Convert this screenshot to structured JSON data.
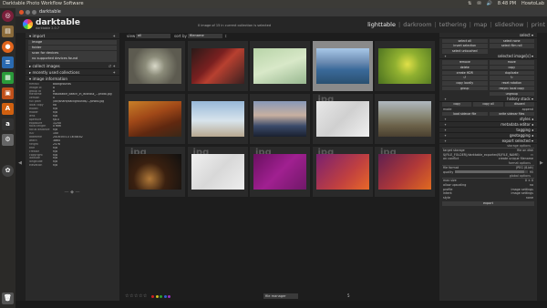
{
  "system": {
    "app_title": "Darktable Photo Workflow Software",
    "tray": [
      "⇅",
      "✉",
      "🔊",
      "8:48 PM",
      "HowtoLab"
    ]
  },
  "window": {
    "title": "darktable"
  },
  "header": {
    "brand": "darktable",
    "subtitle": "darktable 2.0.7",
    "status": "0 image of 15 in current collection is selected",
    "views": [
      "lighttable",
      "darkroom",
      "tethering",
      "map",
      "slideshow",
      "print"
    ],
    "active_view": "lighttable"
  },
  "left": {
    "import_title": "import",
    "import_buttons": [
      "image",
      "folder",
      "scan for devices",
      "no supported devices found"
    ],
    "collect_title": "collect images",
    "recent_title": "recently used collections",
    "info_title": "image information",
    "info_rows": [
      {
        "k": "filmroll",
        "v": "backgrounds"
      },
      {
        "k": "image id",
        "v": "8"
      },
      {
        "k": "group id",
        "v": "8"
      },
      {
        "k": "filename",
        "v": "Mouldable_Beach_in_Istanbul_...photo.jpg"
      },
      {
        "k": "version",
        "v": "0"
      },
      {
        "k": "full path",
        "v": "/usr/share/backgrounds/.../photo.jpg"
      },
      {
        "k": "local copy",
        "v": "no"
      },
      {
        "k": "model",
        "v": "n/a"
      },
      {
        "k": "maker",
        "v": "n/a"
      },
      {
        "k": "lens",
        "v": "n/a"
      },
      {
        "k": "aperture",
        "v": "f/8.0"
      },
      {
        "k": "exposure",
        "v": "1/250"
      },
      {
        "k": "focal length",
        "v": "0 mm"
      },
      {
        "k": "focus distance",
        "v": "n/a"
      },
      {
        "k": "ISO",
        "v": "100"
      },
      {
        "k": "datetime",
        "v": "2016:05:13 16:48:42"
      },
      {
        "k": "width",
        "v": "3864"
      },
      {
        "k": "height",
        "v": "2576"
      },
      {
        "k": "title",
        "v": "n/a"
      },
      {
        "k": "creator",
        "v": "n/a"
      },
      {
        "k": "copyright",
        "v": "n/a"
      },
      {
        "k": "latitude",
        "v": "n/a"
      },
      {
        "k": "longitude",
        "v": "n/a"
      },
      {
        "k": "elevation",
        "v": "n/a"
      }
    ],
    "deco": "— ◆ —"
  },
  "center": {
    "view_label": "view",
    "view_value": "all",
    "sort_label": "sort by",
    "sort_value": "filename",
    "thumbs": [
      {
        "kind": "img",
        "bg": "radial-gradient(circle at 50% 50%, #d8d8c8 0, #8c8c7a 30%, #5d5b50 70%)"
      },
      {
        "kind": "img",
        "bg": "linear-gradient(135deg, #2a1a18 0%, #7a2020 40%, #b84030 55%, #3a2020 100%)"
      },
      {
        "kind": "img",
        "bg": "linear-gradient(160deg, #b8d4a8 0%, #d8e8c8 50%, #98b890 100%)"
      },
      {
        "kind": "img",
        "bg": "linear-gradient(180deg, #a8c8e8 0%, #6a8ab0 40%, #3a6a9a 60%, #2a5070 100%)"
      },
      {
        "kind": "img",
        "bg": "radial-gradient(circle at 55% 45%, #e0e048 0, #90b030 35%, #4a7020 100%)"
      },
      {
        "kind": "img",
        "bg": "linear-gradient(160deg, #c88028 0%, #a04818 40%, #602810 70%, #3a2818 100%)"
      },
      {
        "kind": "img",
        "bg": "linear-gradient(180deg, #98b8d8 0%, #d8e4ec 55%, #b8a890 100%)"
      },
      {
        "kind": "img",
        "bg": "linear-gradient(180deg, #8898b8 0%, #c8b0a0 40%, #3a4a6a 70%, #1a2030 100%)"
      },
      {
        "kind": "placeholder",
        "bg": "linear-gradient(135deg, #e8e8e8 0%, #d0d0d0 50%, #f0f0f0 100%)"
      },
      {
        "kind": "img",
        "bg": "linear-gradient(180deg, #b0b8c0 0%, #8a8a78 40%, #6a6048 70%, #4a4030 100%)"
      },
      {
        "kind": "placeholder",
        "bg": "radial-gradient(circle at 40% 70%, #b07838 0, #3a2010 40%, #101010 100%)"
      },
      {
        "kind": "placeholder",
        "bg": "linear-gradient(135deg, #f0f0f0 0%, #d8d8d8 50%, #eeeeee 100%)"
      },
      {
        "kind": "placeholder",
        "bg": "linear-gradient(135deg, #6a1060 0%, #a02090 50%, #701868 100%)"
      },
      {
        "kind": "placeholder",
        "bg": "linear-gradient(135deg, #7a2070 0%, #c04040 60%, #e86828 100%)"
      },
      {
        "kind": "placeholder",
        "bg": "linear-gradient(135deg, #602050 0%, #b03838 55%, #e06a20 100%)"
      }
    ],
    "placeholder_text": "jpg"
  },
  "bottom": {
    "stars": "☆☆☆☆☆",
    "color_labels": [
      "#d02020",
      "#d0c020",
      "#30a030",
      "#3060d0",
      "#a030c0"
    ],
    "layout": "file manager",
    "zoom": "5"
  },
  "right": {
    "select_title": "select",
    "select_buttons": [
      [
        "select all",
        "select none"
      ],
      [
        "invert selection",
        "select film roll"
      ],
      [
        "select untouched",
        ""
      ]
    ],
    "selected_title": "selected image[s]",
    "selected_buttons": [
      [
        "remove",
        "move"
      ],
      [
        "delete",
        "copy"
      ],
      [
        "create HDR",
        "duplicate"
      ],
      [
        "↺",
        "↻"
      ],
      [
        "copy locally",
        "reset rotation"
      ],
      [
        "group",
        "resync local copy"
      ],
      [
        "",
        "ungroup"
      ]
    ],
    "history_title": "history stack",
    "history_buttons": [
      [
        "copy",
        "copy all",
        "discard"
      ]
    ],
    "mode_label": "mode",
    "mode_value": "append",
    "load_buttons": [
      [
        "load sidecar file",
        "write sidecar files"
      ]
    ],
    "modules": [
      "styles",
      "metadata editor",
      "tagging",
      "geotagging",
      "export selected"
    ],
    "storage_title": "storage options",
    "target_label": "target storage",
    "target_value": "file on disk",
    "path_value": "$(FILE_FOLDER)/darktable_exported/$(FILE_NAME)",
    "on_conflict_label": "on conflict",
    "on_conflict_value": "create unique filename",
    "format_title": "format options",
    "file_format_label": "file format",
    "file_format_value": "JPEG (8-bit)",
    "quality_label": "quality",
    "quality_value": "95",
    "global_title": "global options",
    "max_size_label": "max size",
    "max_w": "0",
    "max_h": "0",
    "upscale_label": "allow upscaling",
    "upscale_value": "no",
    "profile_label": "profile",
    "profile_value": "image settings",
    "intent_label": "intent",
    "intent_value": "image settings",
    "style_label": "style",
    "style_value": "none",
    "export_label": "export"
  }
}
